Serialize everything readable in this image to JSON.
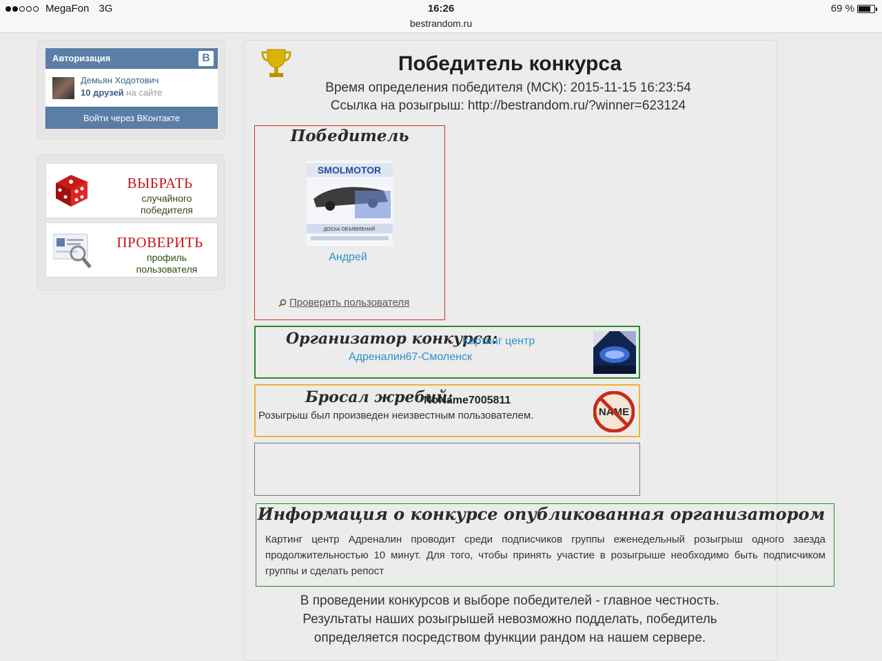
{
  "status_bar": {
    "carrier": "MegaFon",
    "network": "3G",
    "time": "16:26",
    "url": "bestrandom.ru",
    "battery": "69 %"
  },
  "auth": {
    "header": "Авторизация",
    "vk_logo": "В",
    "user_name": "Демьян Ходотович",
    "friends_count": "10 друзей",
    "friends_suffix": "на сайте",
    "login_button": "Войти через ВКонтакте"
  },
  "links": {
    "pick": {
      "title": "ВЫБРАТЬ",
      "line1": "случайного",
      "line2": "победителя"
    },
    "check": {
      "title": "ПРОВЕРИТЬ",
      "line1": "профиль",
      "line2": "пользователя"
    }
  },
  "main": {
    "title": "Победитель конкурса",
    "time_line": "Время определения победителя (МСК): 2015-11-15 16:23:54",
    "link_line": "Ссылка на розыгрыш: http://bestrandom.ru/?winner=623124"
  },
  "winner": {
    "heading": "Победитель",
    "image_text": "SMOLMOTOR",
    "image_sub": "ДОСКА ОБЪЯВЛЕНИЙ",
    "name": "Андрей",
    "check_link": "Проверить пользователя"
  },
  "organizer": {
    "heading": "Организатор конкурса:",
    "name_line1": "Картинг центр",
    "name_line2": "Адреналин67-Смоленск"
  },
  "draw": {
    "heading": "Бросал жребий:",
    "name": "NoName7005811",
    "text": "Розыгрыш был произведен неизвестным пользователем.",
    "badge_text": "NAME"
  },
  "info": {
    "heading": "Информация о конкурсе опубликованная организатором",
    "text": "Картинг центр Адреналин проводит среди подписчиков группы еженедельный розыгрыш одного заезда продолжительностью 10 минут. Для того, чтобы принять участие в розыгрыше необходимо быть подписчиком группы и сделать репост"
  },
  "footer": {
    "line1": "В проведении конкурсов и выборе победителей - главное честность.",
    "line2": "Результаты наших розыгрышей невозможно подделать, победитель",
    "line3": "определяется посредством функции рандом на нашем сервере."
  },
  "colors": {
    "vk_blue": "#5b7ea6",
    "link_blue": "#2b8fc8",
    "winner_border": "#d62a2a",
    "organizer_border": "#2a8a2a",
    "draw_border": "#f0b030",
    "accent_red": "#c0151a"
  },
  "icons": [
    "signal-icon",
    "battery-icon",
    "vk-logo-icon",
    "dice-icon",
    "profile-card-icon",
    "trophy-icon",
    "magnifier-icon",
    "no-name-icon"
  ]
}
